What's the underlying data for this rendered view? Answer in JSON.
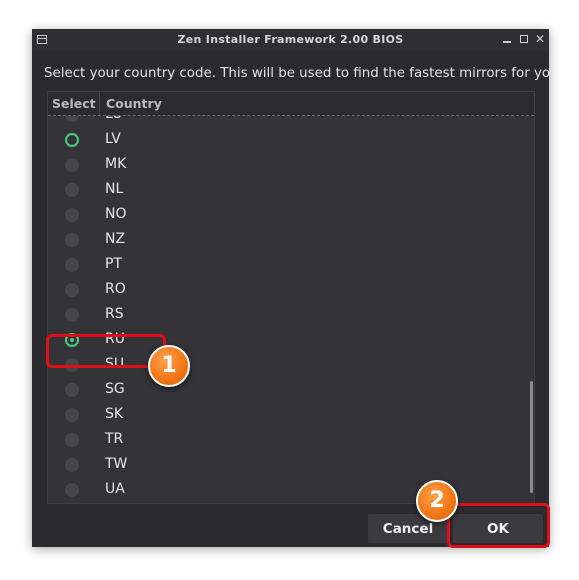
{
  "window": {
    "title": "Zen Installer Framework 2.00 BIOS",
    "controls": {
      "minimize": "-",
      "maximize": "□",
      "close": "✕"
    }
  },
  "prompt": "Select your country code. This will be used to find the fastest mirrors for you",
  "table": {
    "headers": {
      "select": "Select",
      "country": "Country"
    },
    "rows": [
      {
        "code": "LU",
        "selected": false
      },
      {
        "code": "LV",
        "selected": true
      },
      {
        "code": "MK",
        "selected": false
      },
      {
        "code": "NL",
        "selected": false
      },
      {
        "code": "NO",
        "selected": false
      },
      {
        "code": "NZ",
        "selected": false
      },
      {
        "code": "PT",
        "selected": false
      },
      {
        "code": "RO",
        "selected": false
      },
      {
        "code": "RS",
        "selected": false
      },
      {
        "code": "RU",
        "selected": true,
        "checked": true
      },
      {
        "code": "SU",
        "selected": false
      },
      {
        "code": "SG",
        "selected": false
      },
      {
        "code": "SK",
        "selected": false
      },
      {
        "code": "TR",
        "selected": false
      },
      {
        "code": "TW",
        "selected": false
      },
      {
        "code": "UA",
        "selected": false
      }
    ]
  },
  "buttons": {
    "cancel": "Cancel",
    "ok": "OK"
  },
  "annotations": {
    "step1": "1",
    "step2": "2"
  },
  "colors": {
    "accent": "#48d07e",
    "highlight": "#e10e1a",
    "badge": "#f07515"
  }
}
